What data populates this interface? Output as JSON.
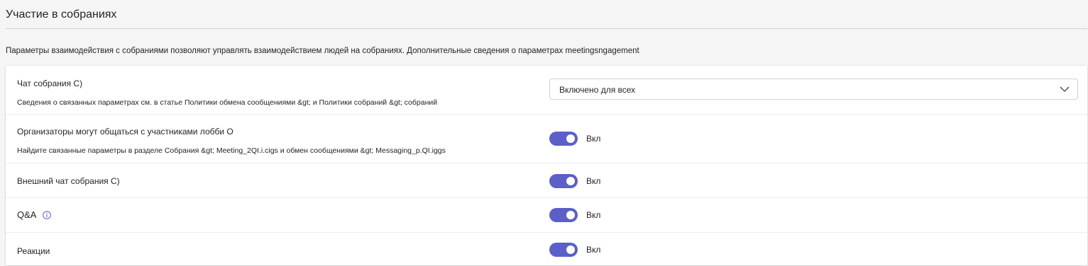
{
  "section": {
    "title": "Участие в собраниях",
    "description": "Параметры взаимодействия с собраниями позволяют управлять взаимодействием людей на собраниях. Дополнительные сведения о параметрах meetingsngagement"
  },
  "settings": {
    "meeting_chat": {
      "label": "Чат собрания C)",
      "sub": "Сведения о связанных параметрах см. в статье Политики обмена сообщениями &gt; и Политики собраний &gt; собраний",
      "value": "Включено для всех",
      "icon": "chevron-down-icon"
    },
    "organizers_lobby": {
      "label": "Организаторы могут общаться с участниками лобби O",
      "sub": "Найдите связанные параметры в разделе Собрания &gt; Meeting_2QI.i.cigs и обмен сообщениями &gt; Messaging_p.QI.iggs",
      "state": "Вкл",
      "on": true
    },
    "external_chat": {
      "label": "Внешний чат собрания C)",
      "state": "Вкл",
      "on": true
    },
    "qa": {
      "label": "Q&A",
      "state": "Вкл",
      "on": true,
      "icon": "info-icon"
    },
    "reactions": {
      "label": "Реакции",
      "state": "Вкл",
      "on": true
    }
  },
  "colors": {
    "toggle_on": "#5b5fc7",
    "background": "#f5f5f5",
    "card": "#ffffff",
    "divider": "#d1d1d1",
    "text": "#242424"
  }
}
